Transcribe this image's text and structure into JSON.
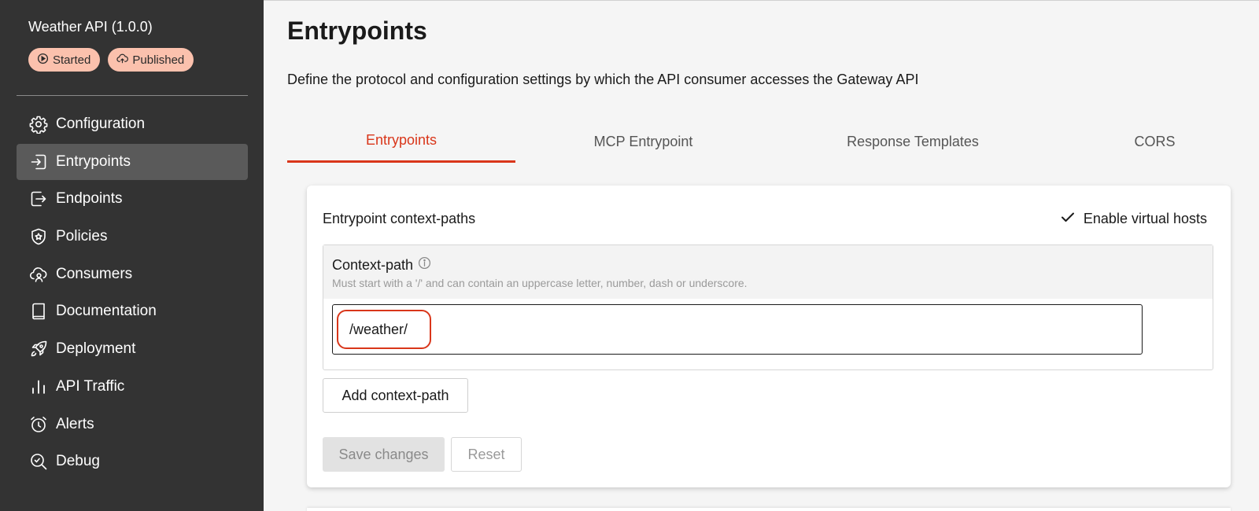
{
  "sidebar": {
    "api_title": "Weather API (1.0.0)",
    "badges": [
      {
        "label": "Started",
        "icon": "play-circle-icon"
      },
      {
        "label": "Published",
        "icon": "cloud-upload-icon"
      }
    ],
    "items": [
      {
        "label": "Configuration",
        "icon": "gear-icon",
        "active": false
      },
      {
        "label": "Entrypoints",
        "icon": "entrypoint-icon",
        "active": true
      },
      {
        "label": "Endpoints",
        "icon": "endpoint-icon",
        "active": false
      },
      {
        "label": "Policies",
        "icon": "shield-icon",
        "active": false
      },
      {
        "label": "Consumers",
        "icon": "consumers-icon",
        "active": false
      },
      {
        "label": "Documentation",
        "icon": "book-icon",
        "active": false
      },
      {
        "label": "Deployment",
        "icon": "rocket-icon",
        "active": false
      },
      {
        "label": "API Traffic",
        "icon": "bar-chart-icon",
        "active": false
      },
      {
        "label": "Alerts",
        "icon": "alarm-clock-icon",
        "active": false
      },
      {
        "label": "Debug",
        "icon": "debug-search-icon",
        "active": false
      }
    ]
  },
  "header": {
    "title": "Entrypoints",
    "description": "Define the protocol and configuration settings by which the API consumer accesses the Gateway API"
  },
  "tabs": [
    {
      "label": "Entrypoints",
      "active": true
    },
    {
      "label": "MCP Entrypoint",
      "active": false
    },
    {
      "label": "Response Templates",
      "active": false
    },
    {
      "label": "CORS",
      "active": false
    }
  ],
  "card": {
    "title": "Entrypoint context-paths",
    "virtual_hosts_label": "Enable virtual hosts",
    "context_path": {
      "label": "Context-path",
      "hint": "Must start with a '/' and can contain an uppercase letter, number, dash or underscore.",
      "value": "/weather/"
    },
    "add_button": "Add context-path",
    "save_button": "Save changes",
    "reset_button": "Reset"
  },
  "colors": {
    "accent": "#d9361a",
    "sidebar_bg": "#333333",
    "badge_bg": "#fbc1ad"
  }
}
